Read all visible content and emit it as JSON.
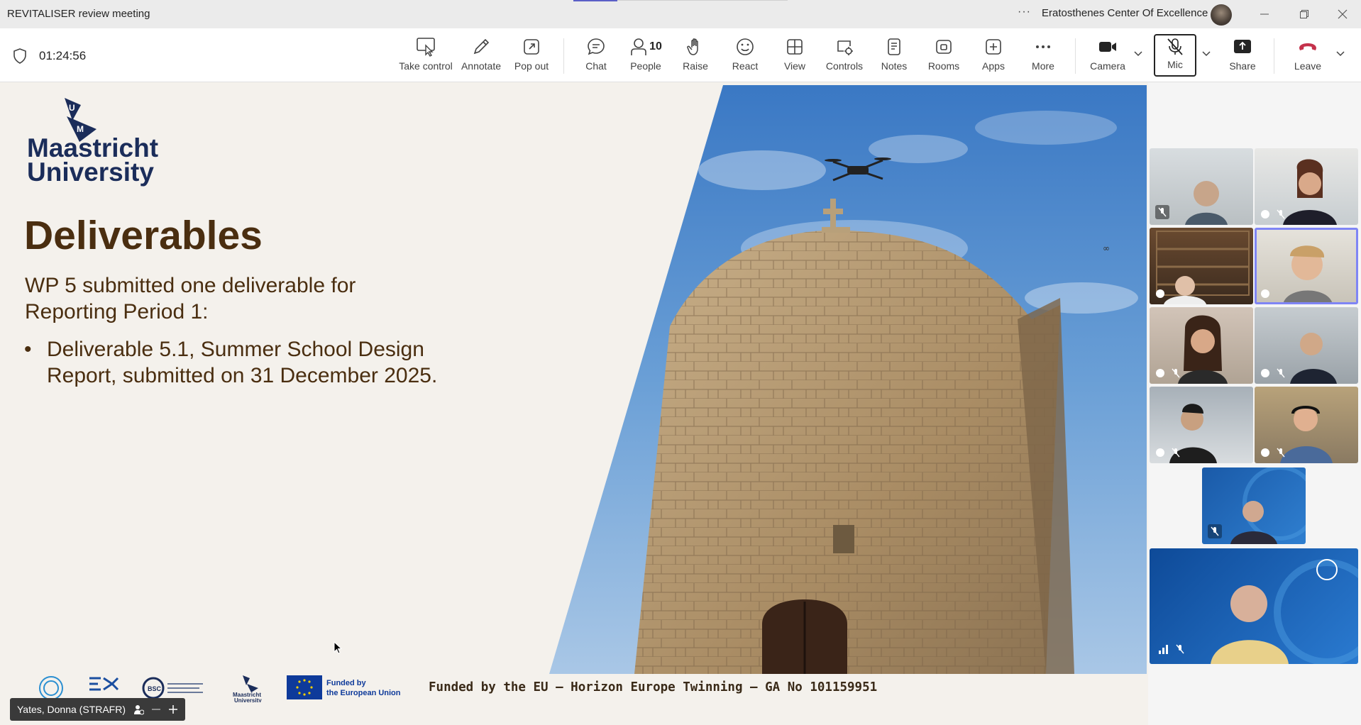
{
  "window": {
    "title": "REVITALISER review meeting",
    "org": "Eratosthenes Center Of Excellence",
    "more": "···"
  },
  "toolbar": {
    "timer": "01:24:56",
    "buttons": [
      {
        "label": "Take control",
        "icon": "take-control-icon"
      },
      {
        "label": "Annotate",
        "icon": "pen-icon"
      },
      {
        "label": "Pop out",
        "icon": "pop-out-icon"
      },
      {
        "label": "Chat",
        "icon": "chat-icon"
      },
      {
        "label": "People",
        "icon": "people-icon",
        "count": "10"
      },
      {
        "label": "Raise",
        "icon": "hand-icon"
      },
      {
        "label": "React",
        "icon": "smile-icon"
      },
      {
        "label": "View",
        "icon": "grid-icon"
      },
      {
        "label": "Controls",
        "icon": "controls-icon"
      },
      {
        "label": "Notes",
        "icon": "notes-icon"
      },
      {
        "label": "Rooms",
        "icon": "rooms-icon"
      },
      {
        "label": "Apps",
        "icon": "plus-icon"
      },
      {
        "label": "More",
        "icon": "more-icon"
      },
      {
        "label": "Camera",
        "icon": "camera-icon"
      },
      {
        "label": "Mic",
        "icon": "mic-off-icon"
      },
      {
        "label": "Share",
        "icon": "share-icon"
      },
      {
        "label": "Leave",
        "icon": "phone-icon"
      }
    ]
  },
  "slide": {
    "logo_mark": "UM",
    "university_line1": "Maastricht",
    "university_line2": "University",
    "title": "Deliverables",
    "subtitle": "WP 5 submitted one deliverable for Reporting Period 1:",
    "bullet": "Deliverable 5.1, Summer School Design Report, submitted on 31 December 2025.",
    "funding_text": "Funded by the EU – Horizon Europe Twinning – GA No 101159951",
    "eu_logo_text": "Funded by the European Union",
    "um_small_logo": "Maastricht University",
    "photo_corner": "∞"
  },
  "presenter": {
    "name": "Yates, Donna (STRAFR)"
  },
  "colors": {
    "accent": "#5b5fc7",
    "leave": "#c4314b",
    "slide_brown": "#4a2e10",
    "um_blue": "#1b2d5a"
  }
}
